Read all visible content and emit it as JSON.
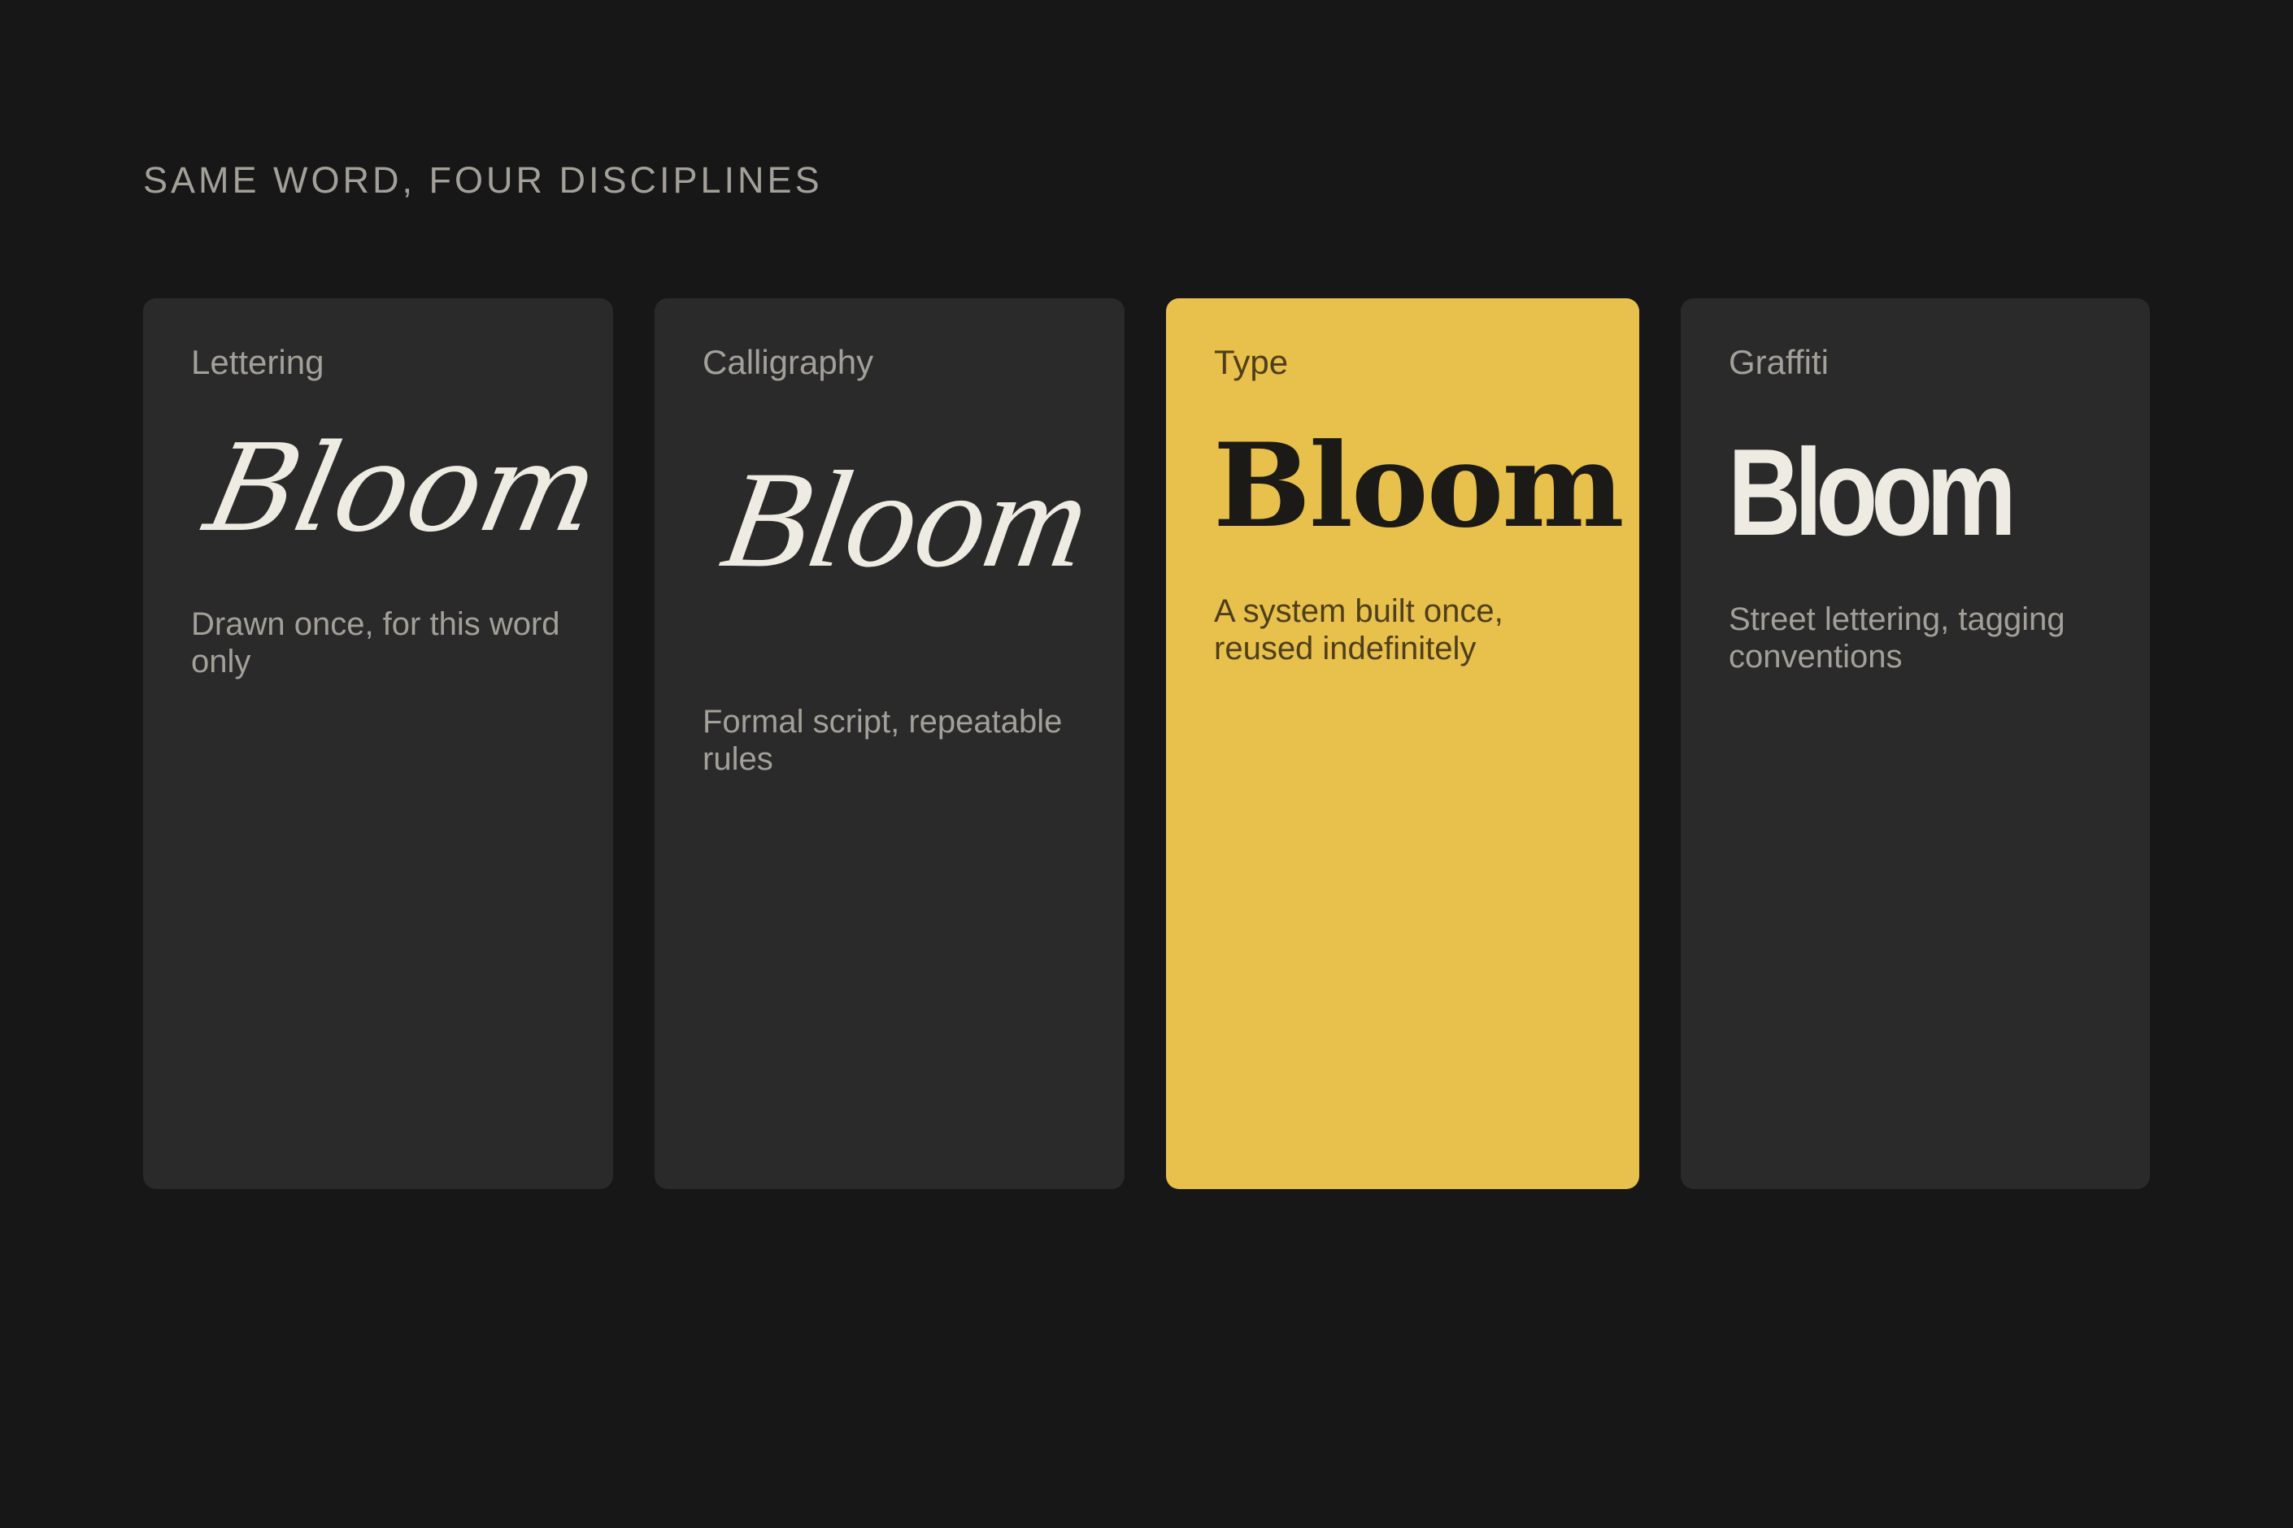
{
  "heading": "SAME WORD, FOUR DISCIPLINES",
  "colors": {
    "background": "#171717",
    "card": "#2a2a2a",
    "accent_card": "#e8c04c",
    "muted_text": "#a3a099",
    "word_light": "#eeebe3",
    "word_dark": "#1c1a16"
  },
  "cards": [
    {
      "label": "Lettering",
      "word": "Bloom",
      "description": "Drawn once, for this word only"
    },
    {
      "label": "Calligraphy",
      "word": "Bloom",
      "description": "Formal script, repeatable rules"
    },
    {
      "label": "Type",
      "word": "Bloom",
      "description": "A system built once, reused indefinitely",
      "highlighted": true
    },
    {
      "label": "Graffiti",
      "word": "Bloom",
      "description": "Street lettering, tagging conventions"
    }
  ]
}
